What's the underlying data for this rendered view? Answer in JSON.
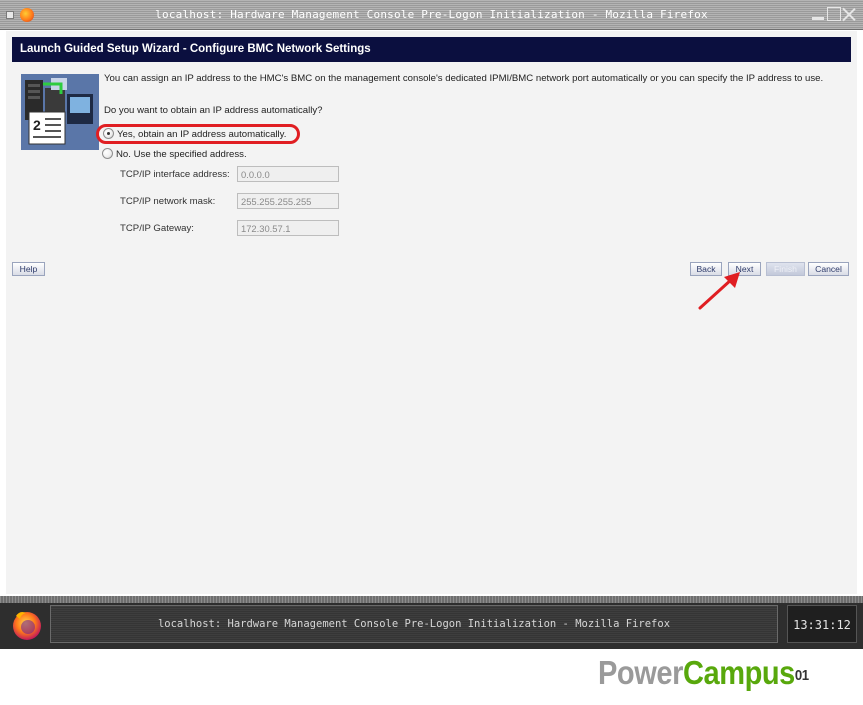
{
  "window": {
    "title": "localhost: Hardware Management Console Pre-Logon Initialization - Mozilla Firefox"
  },
  "page": {
    "header": "Launch Guided Setup Wizard - Configure BMC Network Settings",
    "intro": "You can assign an IP address to the HMC's BMC on the management console's dedicated IPMI/BMC network port automatically or you can specify the IP address to use.",
    "question": "Do you want to obtain an IP address automatically?",
    "options": [
      {
        "label": "Yes, obtain an IP address automatically.",
        "selected": true
      },
      {
        "label": "No. Use the specified address.",
        "selected": false
      }
    ],
    "fields": [
      {
        "label": "TCP/IP interface address:",
        "value": "0.0.0.0"
      },
      {
        "label": "TCP/IP network mask:",
        "value": "255.255.255.255"
      },
      {
        "label": "TCP/IP Gateway:",
        "value": "172.30.57.1"
      }
    ],
    "buttons": {
      "help": "Help",
      "back": "Back",
      "next": "Next",
      "finish": "Finish",
      "cancel": "Cancel"
    }
  },
  "taskbar": {
    "task": "localhost: Hardware Management Console Pre-Logon Initialization - Mozilla Firefox",
    "clock": "13:31:12"
  },
  "watermark": {
    "part1": "Power",
    "part2": "Campus",
    "part3": "01"
  },
  "colors": {
    "header_bg": "#0b0f3f",
    "highlight": "#e01e22",
    "brand_green": "#58a80c"
  }
}
